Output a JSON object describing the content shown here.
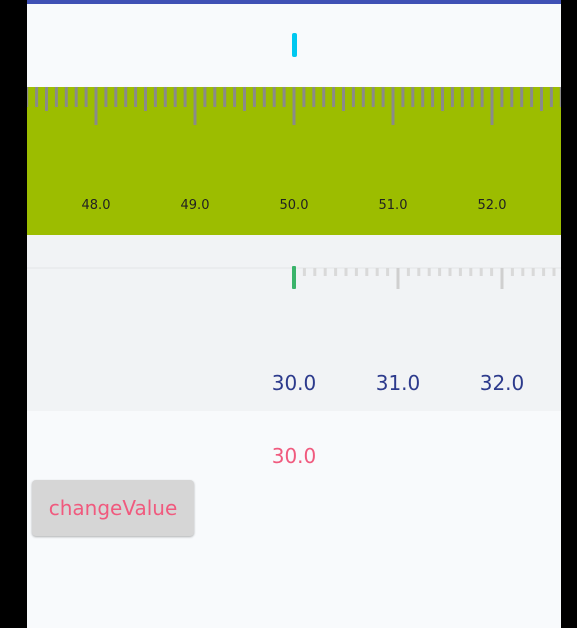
{
  "ruler_top": {
    "value": 50.0,
    "background": "#9cbd00",
    "indicator_color": "#00c8f0",
    "labels": [
      "48.0",
      "49.0",
      "50.0",
      "51.0",
      "52.0"
    ]
  },
  "ruler_bottom": {
    "value": 30.0,
    "indicator_color": "#3ab36a",
    "labels": [
      "30.0",
      "31.0",
      "32.0"
    ]
  },
  "current_value": "30.0",
  "change_button": {
    "label": "changeValue"
  },
  "colors": {
    "accent": "#f05a7e",
    "label_blue": "#2c3a8c",
    "topbar": "#3f51b5"
  }
}
